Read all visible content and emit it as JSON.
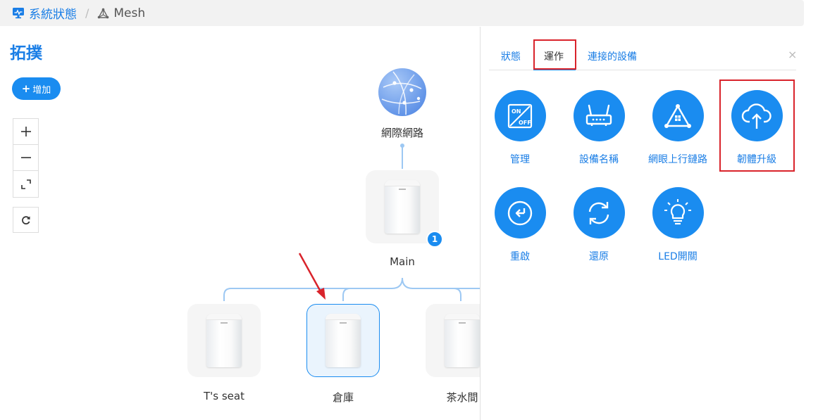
{
  "breadcrumb": {
    "home": "系統狀態",
    "separator": "/",
    "current": "Mesh"
  },
  "topology": {
    "title": "拓撲",
    "add_button": "增加",
    "plus": "+",
    "internet_label": "網際網路",
    "main_label": "Main",
    "main_badge": "1",
    "children": [
      "T's seat",
      "倉庫",
      "茶水間"
    ],
    "selected_child": "倉庫"
  },
  "panel": {
    "tabs": [
      "狀態",
      "運作",
      "連接的設備"
    ],
    "active_tab": "運作",
    "close": "×",
    "actions": [
      {
        "label": "管理",
        "icon": "on-off-switch-icon"
      },
      {
        "label": "設備名稱",
        "icon": "router-icon"
      },
      {
        "label": "網眼上行鏈路",
        "icon": "mesh-uplink-icon"
      },
      {
        "label": "韌體升級",
        "icon": "cloud-upload-icon"
      },
      {
        "label": "重啟",
        "icon": "reboot-icon"
      },
      {
        "label": "還原",
        "icon": "restore-icon"
      },
      {
        "label": "LED開關",
        "icon": "led-bulb-icon"
      }
    ]
  },
  "colors": {
    "accent": "#1a8cf0",
    "highlight": "#d9232b",
    "annotation_arrow": "#d9232b"
  }
}
